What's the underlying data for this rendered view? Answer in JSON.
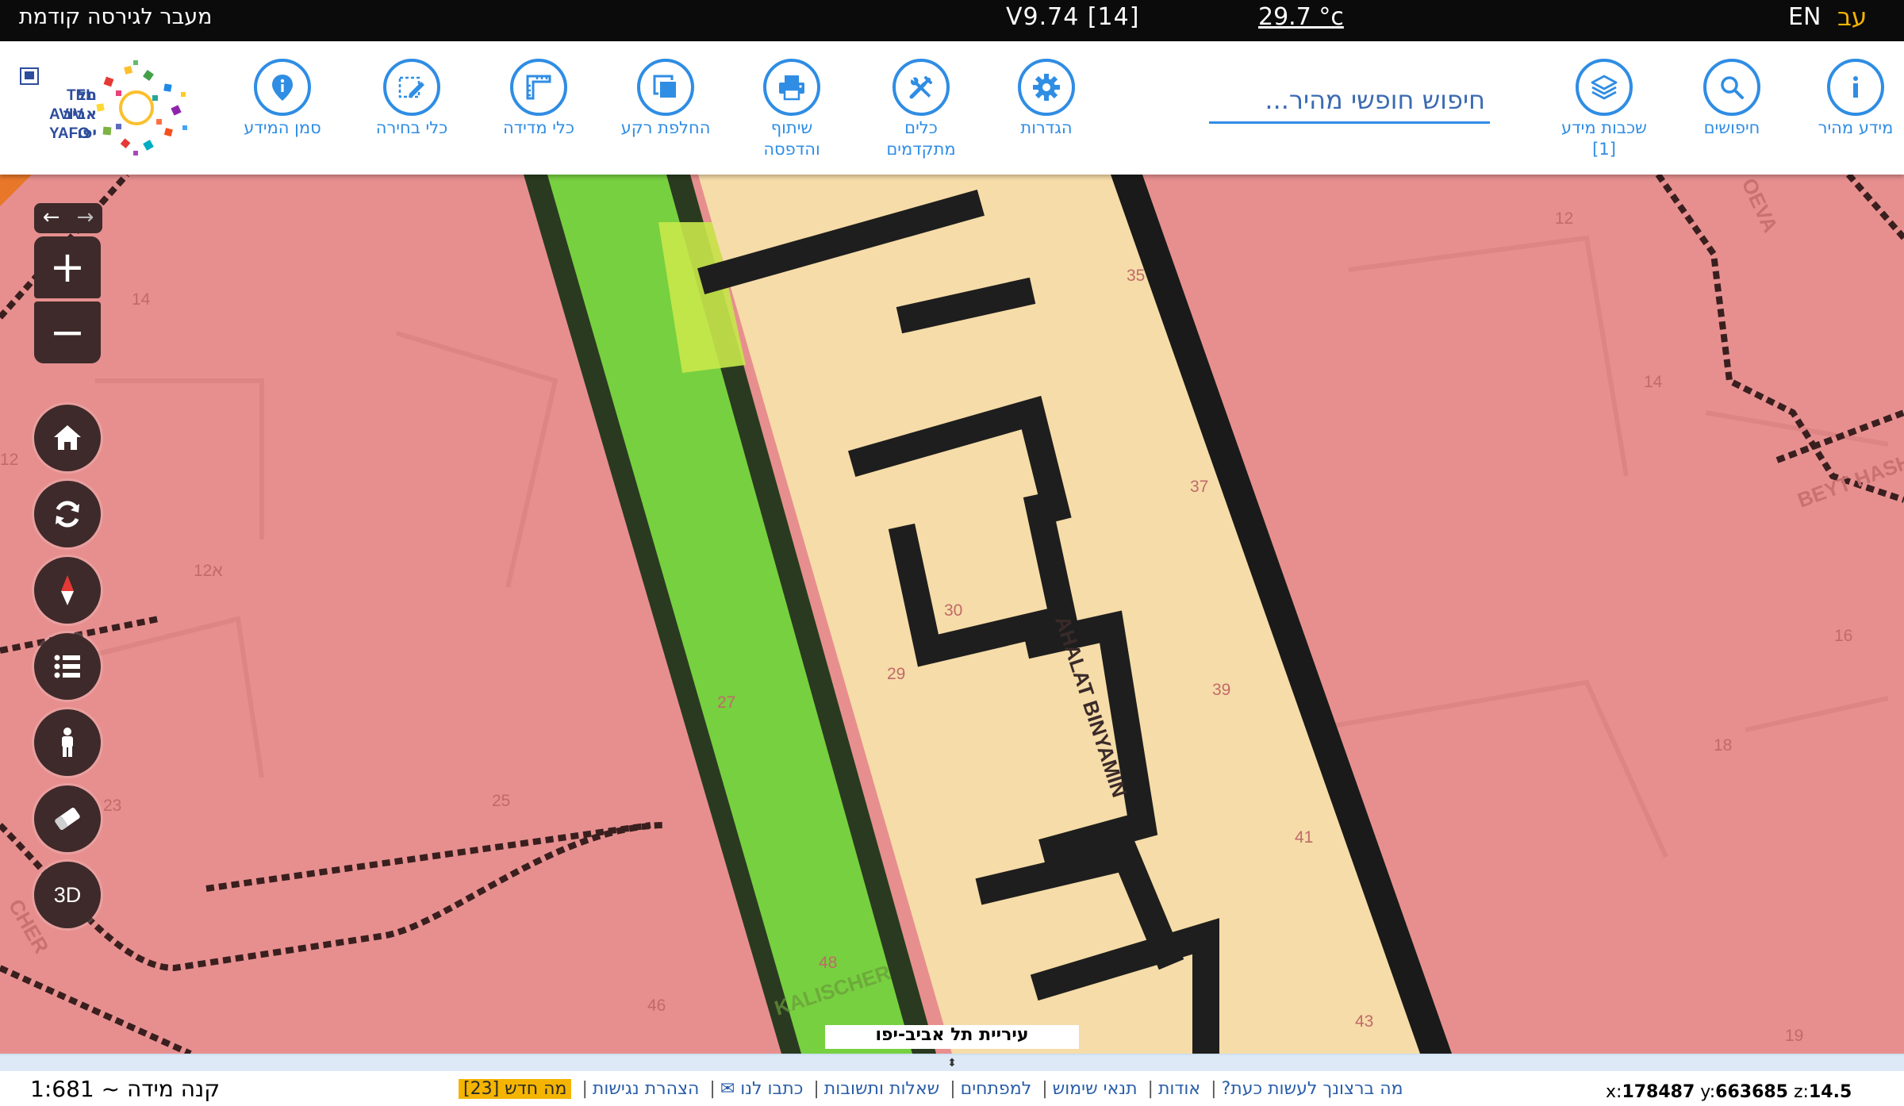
{
  "topbar": {
    "prev_version": "מעבר לגירסה קודמת",
    "version": "V9.74 [14]",
    "temperature": "29.7 °c",
    "lang_en": "EN",
    "lang_he": "עב"
  },
  "toolbar": {
    "logo_alt": "TEL AVIV YAFO",
    "logo_text_en1": "TEL",
    "logo_text_en2": "AVIV",
    "logo_text_en3": "YAFO",
    "logo_text_he1": "תל",
    "logo_text_he2": "אביב",
    "logo_text_he3": "יפו",
    "search_placeholder": "חיפוש חופשי מהיר...",
    "tools": {
      "mark_info": "סמן המידע",
      "select_tools": "כלי בחירה",
      "measure_tools": "כלי מדידה",
      "basemap": "החלפת רקע",
      "share_print_1": "שיתוף",
      "share_print_2": "והדפסה",
      "advanced_1": "כלים",
      "advanced_2": "מתקדמים",
      "settings": "הגדרות",
      "layers_1": "שכבות מידע",
      "layers_2": "[1]",
      "searches": "חיפושים",
      "quick_info": "מידע מהיר"
    }
  },
  "map": {
    "caption": "עיריית תל אביב-יפו",
    "street_labels": [
      "KALISCHER",
      "AHALAT BINYAMIN",
      "OEVA",
      "BEYT HASH",
      "CHER"
    ],
    "parcel_numbers": [
      "14",
      "12",
      "12א",
      "23",
      "25",
      "27",
      "29",
      "30",
      "37",
      "35",
      "39",
      "41",
      "43",
      "46",
      "48",
      "12",
      "14",
      "16",
      "18",
      "19"
    ],
    "controls": {
      "three_d": "3D"
    }
  },
  "bottombar": {
    "scale": "קנה מידה ~ 1:681",
    "coords_x_label": "x:",
    "coords_x": "178487",
    "coords_y_label": "y:",
    "coords_y": "663685",
    "coords_z_label": "z:",
    "coords_z": "14.5",
    "links": {
      "what_now": "מה ברצונך לעשות כעת?",
      "about": "אודות",
      "terms": "תנאי שימוש",
      "developers": "למפתחים",
      "faq": "שאלות ותשובות",
      "contact": "כתבו לנו ✉",
      "accessibility": "הצהרת נגישות",
      "whats_new": "מה חדש [23]"
    }
  }
}
